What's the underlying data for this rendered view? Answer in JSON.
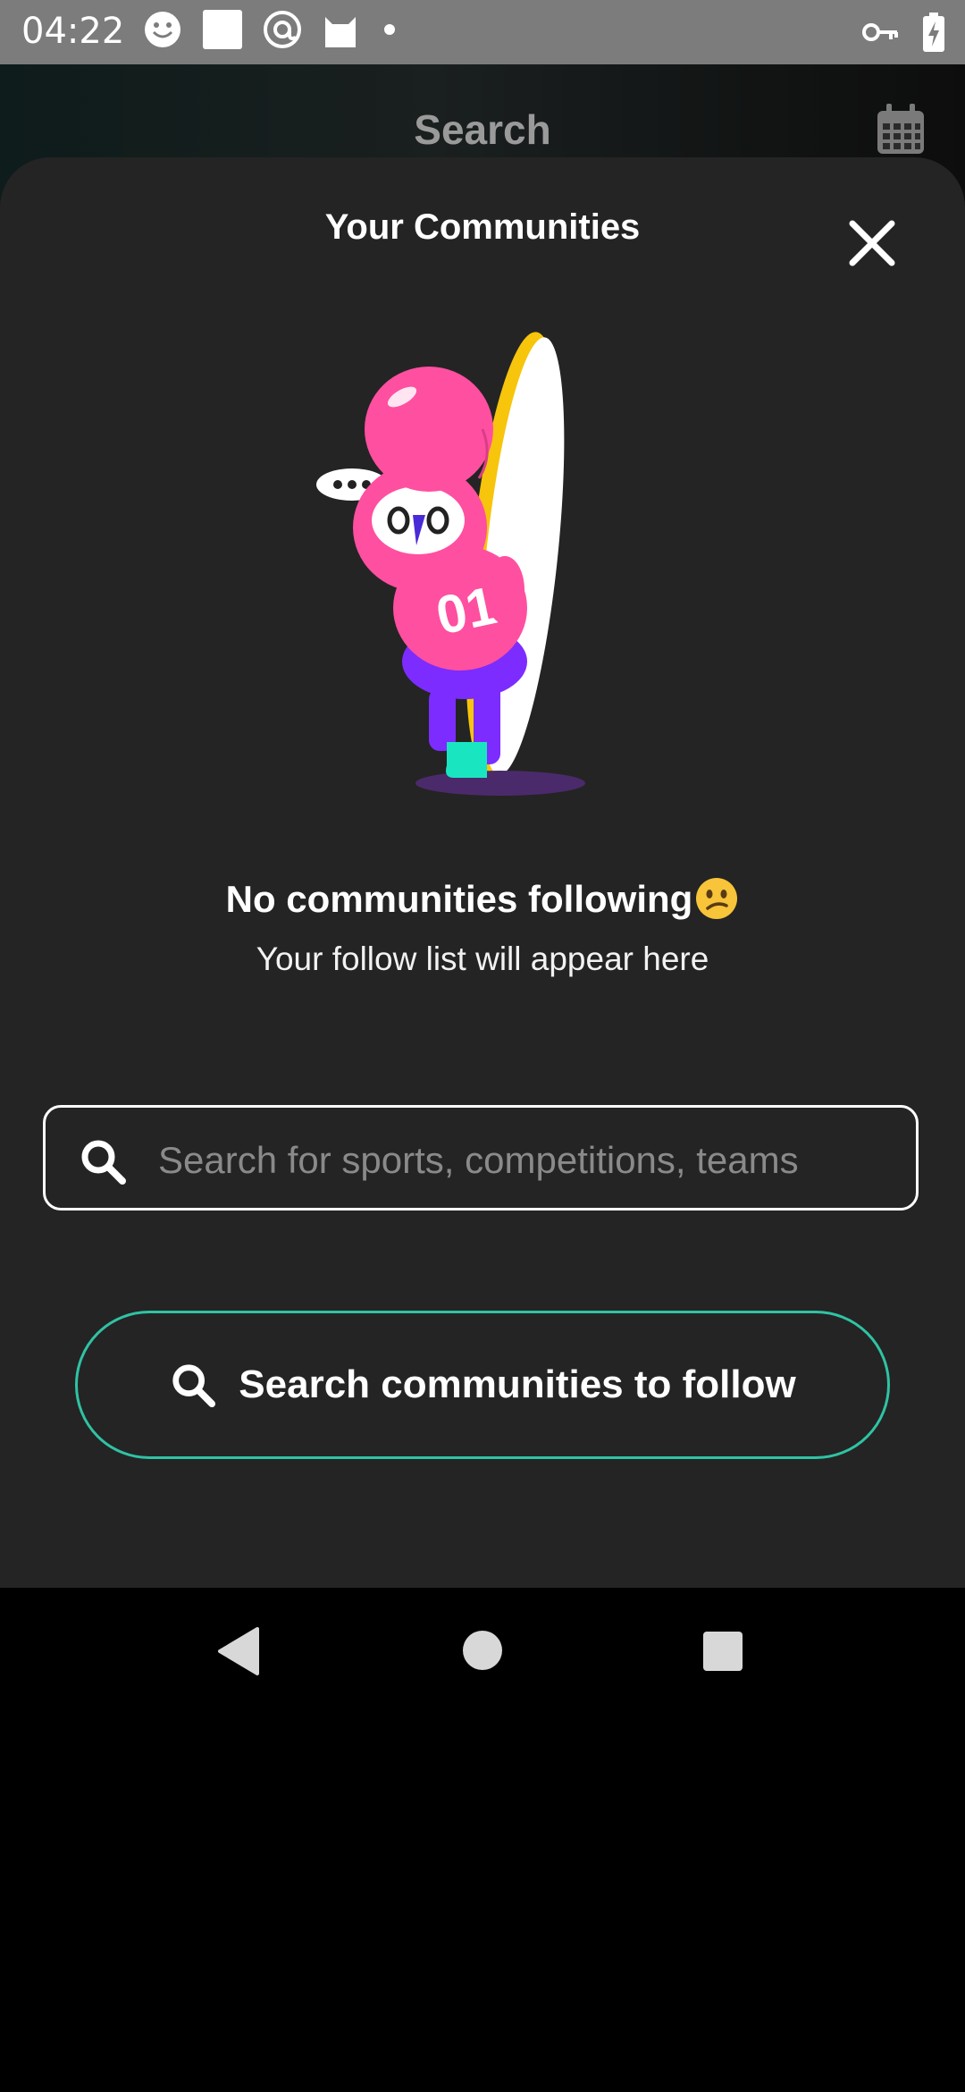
{
  "status_bar": {
    "time": "04:22",
    "icons": [
      "smiley-icon",
      "square-icon",
      "at-icon",
      "cat-icon",
      "dot-icon"
    ],
    "right_icons": [
      "key-icon",
      "battery-charging-icon"
    ],
    "background": "#7c7c7c"
  },
  "header": {
    "title": "Search",
    "calendar_icon": "calendar-icon"
  },
  "sheet": {
    "title": "Your Communities",
    "close_icon": "close-icon",
    "illustration": "pink-mascot-illustration",
    "empty_title": "No communities following",
    "empty_emoji": "confused-face-emoji",
    "empty_subtitle": "Your follow list will appear here",
    "search": {
      "placeholder": "Search for sports, competitions, teams",
      "value": "",
      "icon": "search-icon"
    },
    "follow_button": {
      "label": "Search communities to follow",
      "icon": "search-icon",
      "accent_color": "#2fc3a4"
    }
  },
  "nav_bar": {
    "back_icon": "back-triangle-icon",
    "home_icon": "home-circle-icon",
    "recent_icon": "recents-square-icon"
  }
}
